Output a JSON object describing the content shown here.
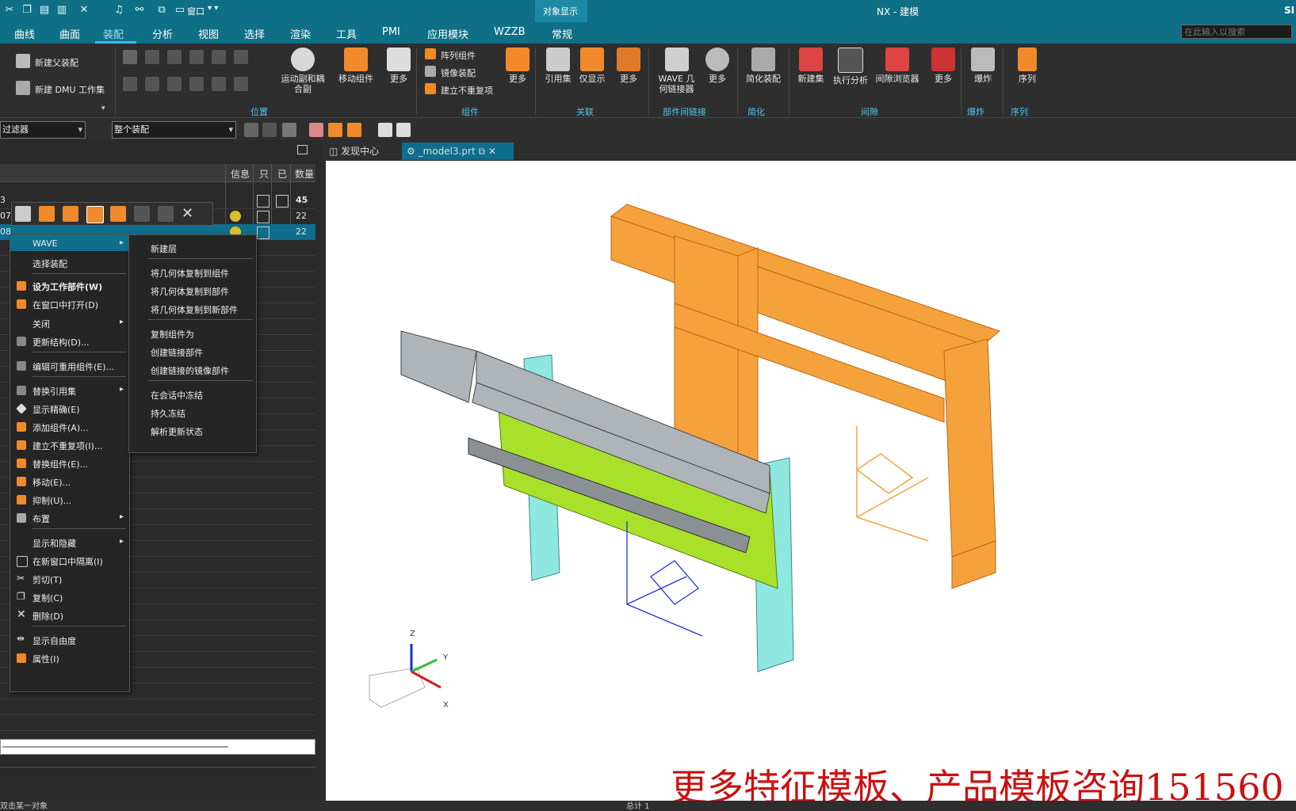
{
  "window": {
    "title": "NX - 建模",
    "right_fragment": "SI",
    "search_placeholder": "在此输入以搜索",
    "context_group_label": "对象显示",
    "quick_menu": "窗口"
  },
  "menu_tabs": [
    "曲线",
    "曲面",
    "装配",
    "分析",
    "视图",
    "选择",
    "渲染",
    "工具",
    "PMI",
    "应用模块",
    "WZZB",
    "常规"
  ],
  "active_tab": "装配",
  "ribbon": {
    "left_buttons": [
      "新建父装配",
      "新建 DMU 工作集"
    ],
    "position_buttons": [
      "运动副和耦合副",
      "移动组件",
      "更多"
    ],
    "component_buttons": [
      "阵列组件",
      "镜像装配",
      "建立不重复项"
    ],
    "component_more": "更多",
    "relation_buttons": [
      "引用集",
      "仅显示",
      "更多"
    ],
    "link_buttons": [
      "WAVE 几何链接器",
      "更多"
    ],
    "simplify_buttons": [
      "简化装配"
    ],
    "clearance_buttons": [
      "新建集",
      "执行分析",
      "间隙浏览器",
      "更多"
    ],
    "explode_buttons": [
      "爆炸"
    ],
    "sequence_buttons": [
      "序列"
    ],
    "groups": [
      "位置",
      "组件",
      "关联",
      "部件间链接",
      "简化",
      "间隙",
      "爆炸",
      "序列"
    ]
  },
  "filter": {
    "filter_value": "过滤器",
    "scope_value": "整个装配"
  },
  "doc_tabs": [
    {
      "label": "发现中心"
    },
    {
      "label": "_model3.prt"
    }
  ],
  "navigator": {
    "columns": [
      "信息",
      "只",
      "已",
      "数量"
    ],
    "rows": [
      {
        "name": "3",
        "count": "45"
      },
      {
        "name": "07",
        "count": "22"
      },
      {
        "name": "08",
        "count": "22"
      }
    ]
  },
  "context_menu": {
    "items": [
      {
        "label": "WAVE",
        "submenu": true
      },
      {
        "label": "选择装配"
      },
      {
        "label": "设为工作部件(W)"
      },
      {
        "label": "在窗口中打开(D)"
      },
      {
        "label": "关闭",
        "submenu": true
      },
      {
        "label": "更新结构(D)..."
      },
      {
        "label": "编辑可重用组件(E)..."
      },
      {
        "label": "替换引用集",
        "submenu": true
      },
      {
        "label": "显示精确(E)"
      },
      {
        "label": "添加组件(A)..."
      },
      {
        "label": "建立不重复项(I)..."
      },
      {
        "label": "替换组件(E)..."
      },
      {
        "label": "移动(E)..."
      },
      {
        "label": "抑制(U)..."
      },
      {
        "label": "布置",
        "submenu": true
      },
      {
        "label": "显示和隐藏",
        "submenu": true
      },
      {
        "label": "在新窗口中隔离(I)"
      },
      {
        "label": "剪切(T)"
      },
      {
        "label": "复制(C)"
      },
      {
        "label": "删除(D)"
      },
      {
        "label": "显示自由度"
      },
      {
        "label": "属性(I)"
      }
    ]
  },
  "wave_submenu": {
    "items": [
      "新建层",
      "将几何体复制到组件",
      "将几何体复制到部件",
      "将几何体复制到新部件",
      "复制组件为",
      "创建链接部件",
      "创建链接的镜像部件",
      "在会话中冻结",
      "持久冻结",
      "解析更新状态"
    ]
  },
  "viewport": {
    "axis_labels": [
      "Z",
      "Y",
      "X"
    ]
  },
  "promo_text": "更多特征模板、产品模板咨询151560",
  "status": {
    "left": "双击某一对象",
    "center": "总计 1"
  },
  "colors": {
    "titlebar": "#0f6f86",
    "accent": "#4fc6ee",
    "selected_row": "#0e6e8c",
    "orange_part": "#f5a23c",
    "cyan_part": "#8ee8e0",
    "green_plate": "#a8e02a",
    "promo": "#cc1010"
  }
}
